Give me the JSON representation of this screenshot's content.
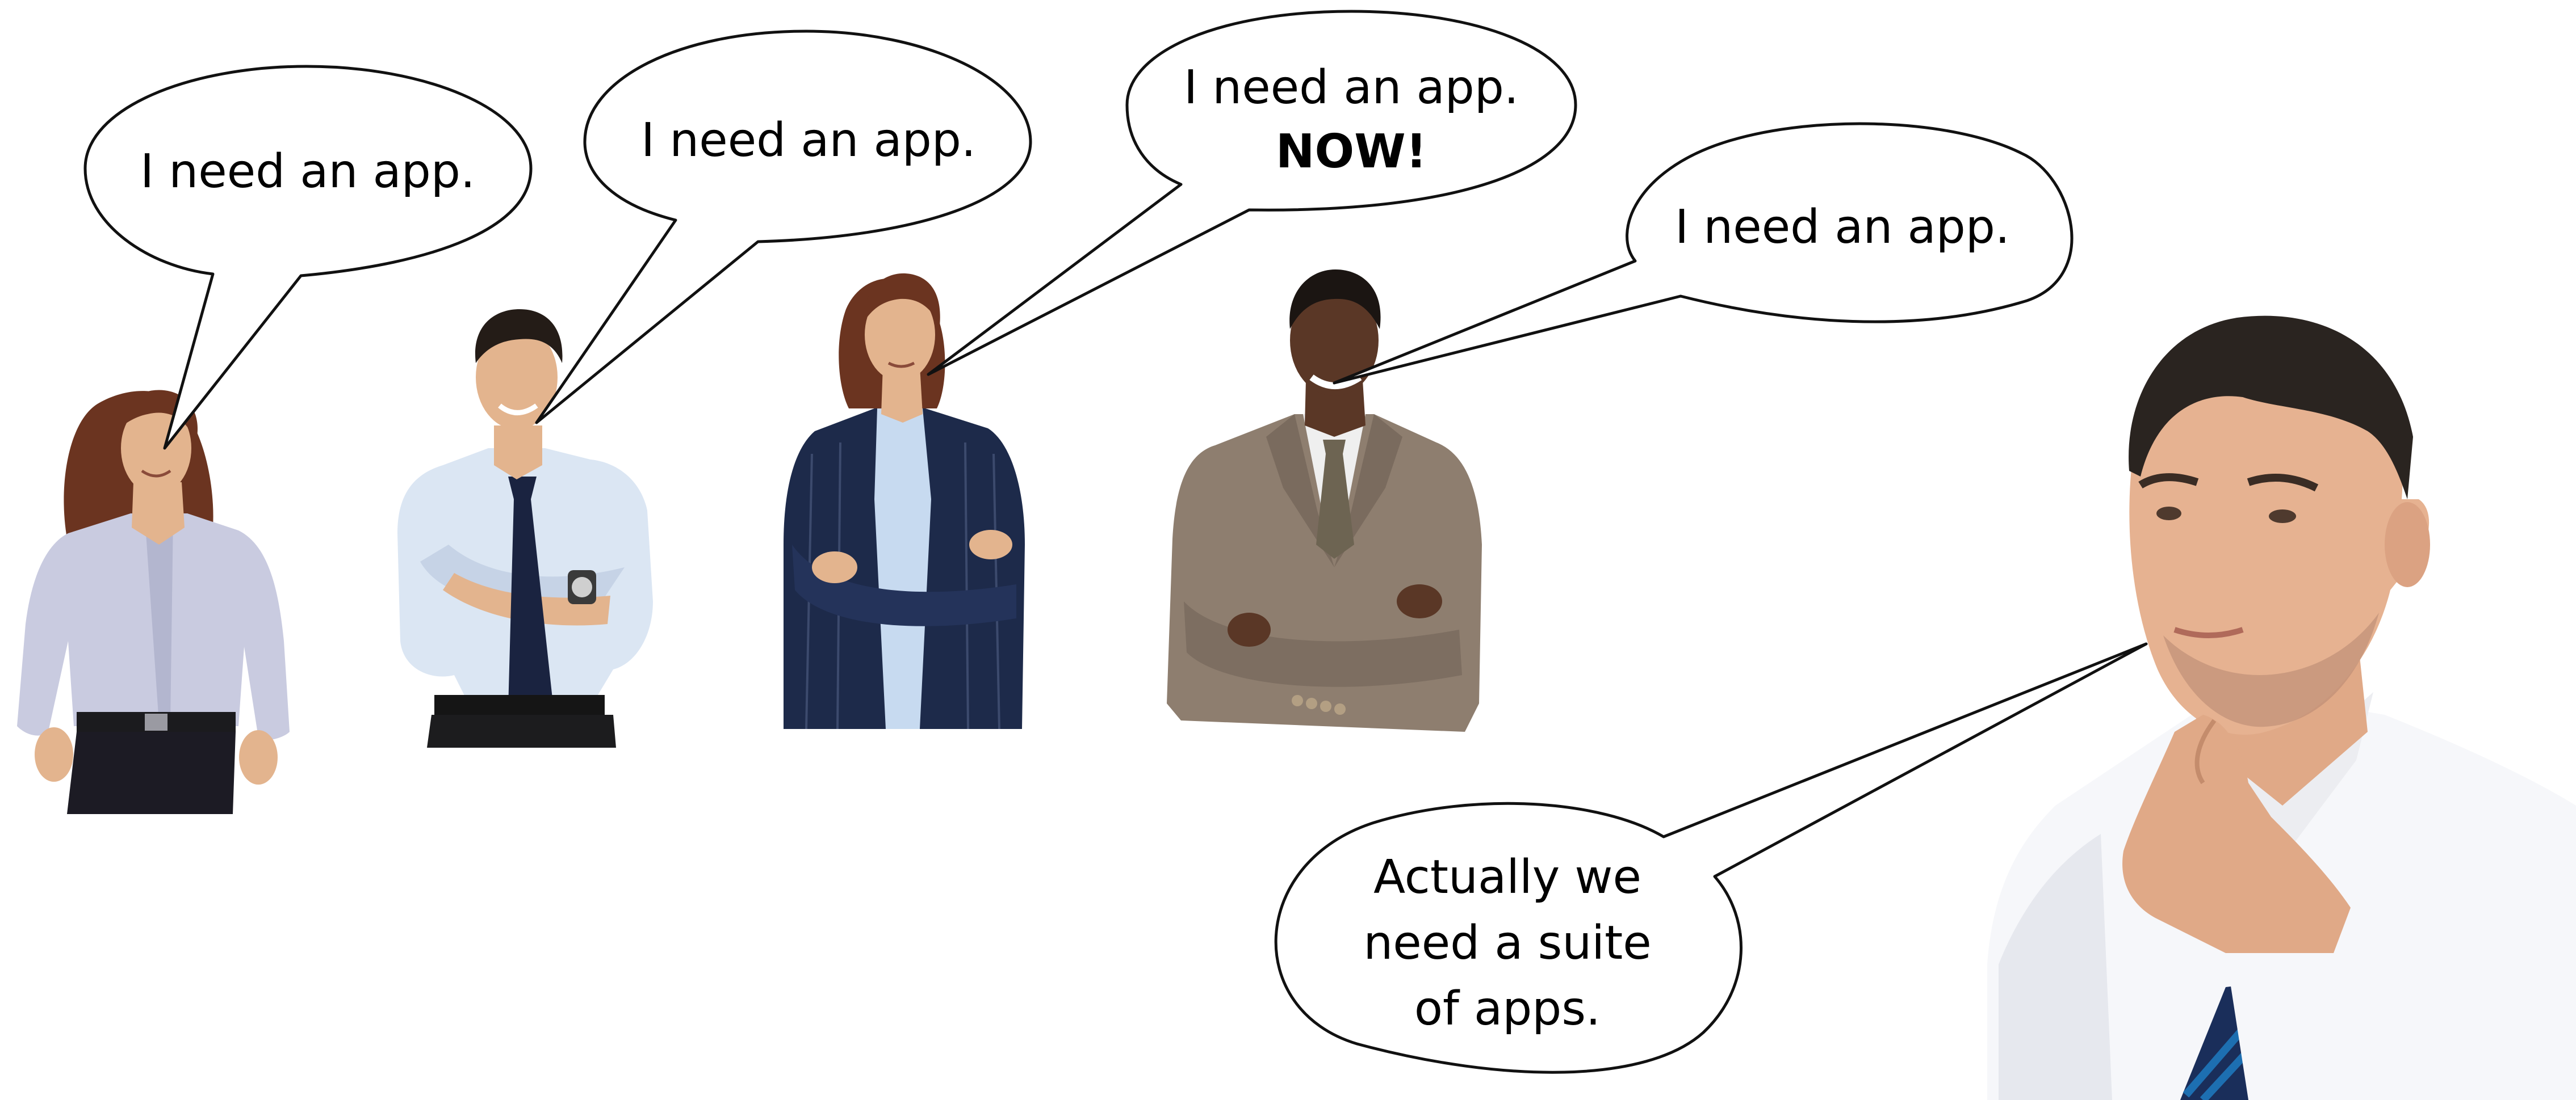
{
  "bubbles": [
    {
      "lines": [
        {
          "text": "I need an app."
        }
      ]
    },
    {
      "lines": [
        {
          "text": "I need an app."
        }
      ]
    },
    {
      "lines": [
        {
          "text": "I need an app."
        },
        {
          "text": "NOW!"
        }
      ]
    },
    {
      "lines": [
        {
          "text": "I need an app."
        }
      ]
    },
    {
      "lines": [
        {
          "text": "Actually we"
        },
        {
          "text": "need a suite"
        },
        {
          "text": "of apps."
        }
      ]
    }
  ],
  "colors": {
    "bubble_stroke": "#111111",
    "bubble_fill": "#ffffff",
    "shirt_lavender": "#c9cbe0",
    "shirt_blue": "#dbe6f3",
    "tie_navy": "#1a2340",
    "suit_navy": "#1d2a4a",
    "suit_tan": "#8e7e6f",
    "shirt_white": "#f6f7fa",
    "tie_blue_stripe": "#1d6fb1",
    "skin": "#e3b48e",
    "hair_brown": "#6b3420",
    "hair_dark": "#241c17"
  }
}
